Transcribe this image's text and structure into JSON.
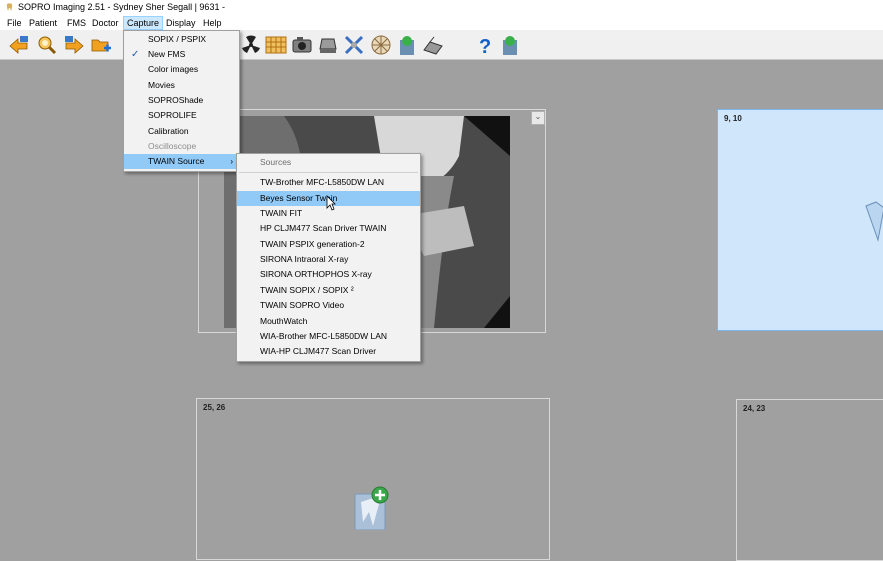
{
  "window": {
    "title": "SOPRO Imaging 2.51 -  Sydney Sher Segall | 9631 -"
  },
  "menubar": [
    "File",
    "Patient",
    "FMS",
    "Doctor",
    "Capture",
    "Display",
    "Help"
  ],
  "capture_menu": {
    "items": [
      {
        "label": "SOPIX / PSPIX",
        "enabled": true,
        "checked": false
      },
      {
        "label": "New FMS",
        "enabled": true,
        "checked": true
      },
      {
        "label": "Color images",
        "enabled": true,
        "checked": false
      },
      {
        "label": "Movies",
        "enabled": true,
        "checked": false
      },
      {
        "label": "SOPROShade",
        "enabled": true,
        "checked": false
      },
      {
        "label": "SOPROLIFE",
        "enabled": true,
        "checked": false
      },
      {
        "label": "Calibration",
        "enabled": true,
        "checked": false
      },
      {
        "label": "Oscilloscope",
        "enabled": false,
        "checked": false
      },
      {
        "label": "TWAIN Source",
        "enabled": true,
        "checked": false,
        "submenu": true
      }
    ]
  },
  "twain_submenu": {
    "header": "Sources",
    "items": [
      "TW-Brother MFC-L5850DW LAN",
      "Beyes Sensor Twain",
      "TWAIN FIT",
      "HP CLJM477 Scan Driver TWAIN",
      "TWAIN PSPIX generation-2",
      "SIRONA Intraoral X-ray",
      "SIRONA ORTHOPHOS X-ray",
      "TWAIN SOPIX / SOPIX ²",
      "TWAIN SOPRO Video",
      "MouthWatch",
      "WIA-Brother MFC-L5850DW LAN",
      "WIA-HP CLJM477 Scan Driver"
    ],
    "highlighted_index": 1
  },
  "tiles": {
    "selected_label": "9, 10",
    "bottom_left_label": "25, 26",
    "bottom_right_label": "24, 23"
  },
  "toolbar_icons": [
    "back-arrow-icon",
    "search-image-icon",
    "forward-arrow-icon",
    "add-folder-icon",
    "radiation-icon",
    "sensor-icon",
    "camera-icon",
    "scanner-icon",
    "tools-icon",
    "color-wheel-icon",
    "tooth-green-icon",
    "scanner-flatbed-icon",
    "help-icon",
    "tooth-help-icon"
  ],
  "colors": {
    "workspace": "#a0a0a0",
    "selected_tile": "#cfe6fb",
    "menu_highlight": "#91c9f7"
  }
}
